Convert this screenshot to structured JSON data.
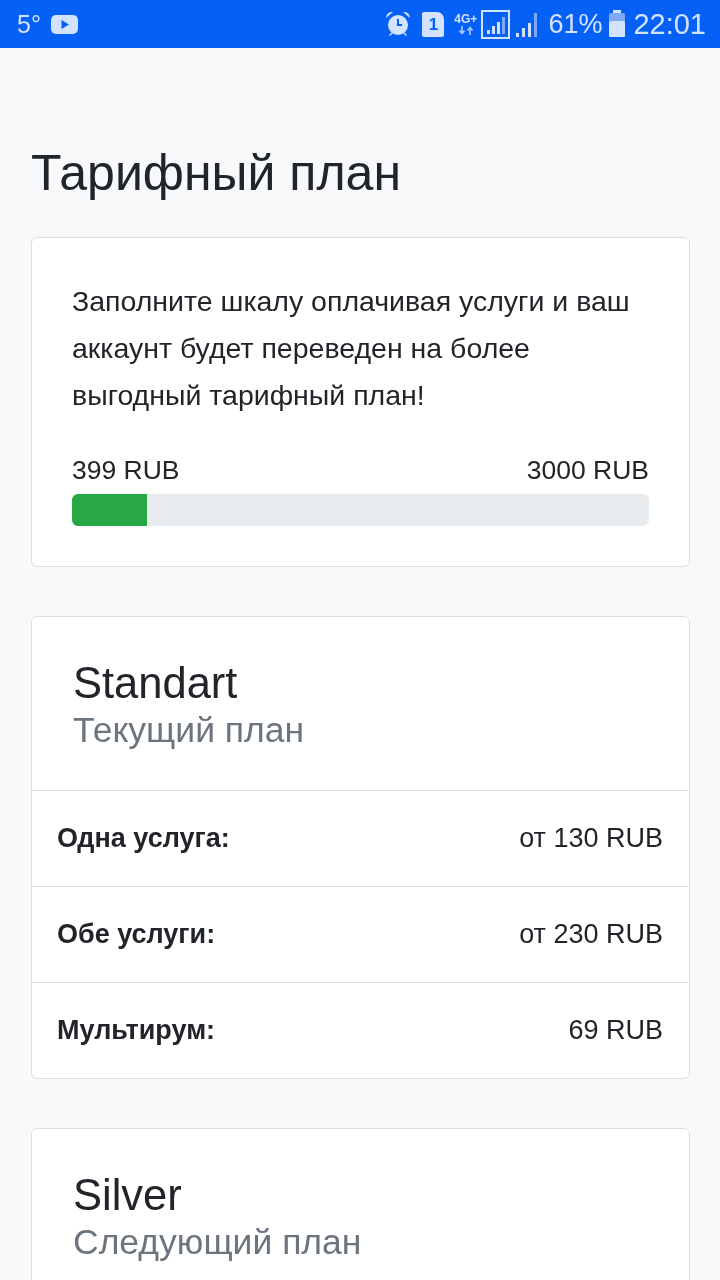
{
  "status_bar": {
    "temperature": "5°",
    "sim_slot": "1",
    "network_type": "4G+",
    "battery": "61%",
    "time": "22:01"
  },
  "title": "Тарифный план",
  "progress_card": {
    "text": "Заполните шкалу оплачивая услуги и ваш аккаунт будет переведен на более выгодный тарифный план!",
    "current": "399 RUB",
    "target": "3000 RUB",
    "level": 0.13
  },
  "plans": [
    {
      "name": "Standart",
      "status": "Текущий план",
      "rows": [
        {
          "label": "Одна услуга:",
          "value": "от 130 RUB"
        },
        {
          "label": "Обе услуги:",
          "value": "от 230 RUB"
        },
        {
          "label": "Мультирум:",
          "value": "69 RUB"
        }
      ]
    },
    {
      "name": "Silver",
      "status": "Следующий план"
    }
  ]
}
